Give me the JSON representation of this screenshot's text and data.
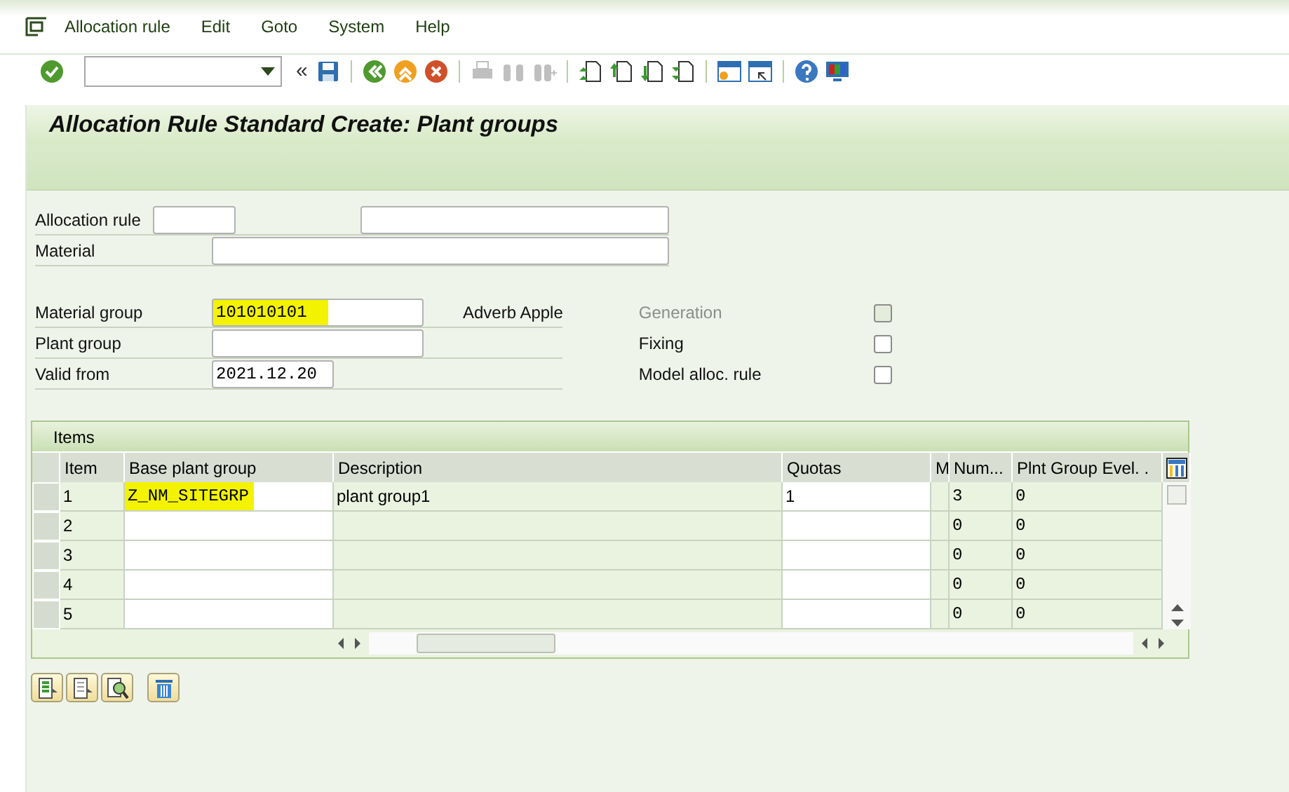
{
  "menu": [
    {
      "label": "Allocation rule"
    },
    {
      "label": "Edit"
    },
    {
      "label": "Goto"
    },
    {
      "label": "System"
    },
    {
      "label": "Help"
    }
  ],
  "toolbar": {
    "back_glyph": "«",
    "buttons": [
      {
        "kind": "save",
        "disabled": false
      },
      {
        "kind": "sep"
      },
      {
        "kind": "back",
        "disabled": false
      },
      {
        "kind": "exit",
        "disabled": false
      },
      {
        "kind": "cancel",
        "disabled": false
      },
      {
        "kind": "sep"
      },
      {
        "kind": "print",
        "disabled": true
      },
      {
        "kind": "find",
        "disabled": true
      },
      {
        "kind": "findnext",
        "disabled": true
      },
      {
        "kind": "sep"
      },
      {
        "kind": "first",
        "disabled": false
      },
      {
        "kind": "prev",
        "disabled": false
      },
      {
        "kind": "next",
        "disabled": false
      },
      {
        "kind": "last",
        "disabled": false
      },
      {
        "kind": "sep"
      },
      {
        "kind": "newsession",
        "disabled": false
      },
      {
        "kind": "shortcut",
        "disabled": false
      },
      {
        "kind": "sep"
      },
      {
        "kind": "help",
        "disabled": false
      },
      {
        "kind": "layout",
        "disabled": false
      }
    ]
  },
  "title": "Allocation Rule Standard Create: Plant groups",
  "header_fields": [
    {
      "label": "Allocation rule"
    },
    {
      "label": "Material"
    }
  ],
  "fields": [
    {
      "label": "Material group",
      "value": "101010101",
      "highlighted": true
    },
    {
      "label": "Plant group",
      "highlighted": false
    },
    {
      "label": "Valid from",
      "value": "2021.12.20",
      "highlighted": false
    }
  ],
  "material_group_text": "Adverb Apple",
  "flags": [
    {
      "label": "Generation",
      "checked": false,
      "disabled": true
    },
    {
      "label": "Fixing",
      "checked": false,
      "disabled": false
    },
    {
      "label": "Model alloc. rule",
      "checked": false,
      "disabled": false
    }
  ],
  "items": {
    "title": "Items",
    "columns": [
      "Item",
      "Base plant group",
      "Description",
      "Quotas",
      "M",
      "Num...",
      "Plnt Group Evel. ."
    ],
    "rows": [
      {
        "item": "1",
        "base": "Z_NM_SITEGRP",
        "base_highlighted": true,
        "description": "plant group1",
        "quotas": "1",
        "num": "3",
        "plnt": "0"
      },
      {
        "item": "2",
        "base_highlighted": false,
        "num": "0",
        "plnt": "0"
      },
      {
        "item": "3",
        "base_highlighted": false,
        "num": "0",
        "plnt": "0"
      },
      {
        "item": "4",
        "base_highlighted": false,
        "num": "0",
        "plnt": "0"
      },
      {
        "item": "5",
        "base_highlighted": false,
        "num": "0",
        "plnt": "0"
      }
    ]
  },
  "bottom_buttons": [
    {
      "kind": "select-all"
    },
    {
      "kind": "deselect"
    },
    {
      "kind": "details"
    },
    {
      "kind": "delete"
    }
  ]
}
